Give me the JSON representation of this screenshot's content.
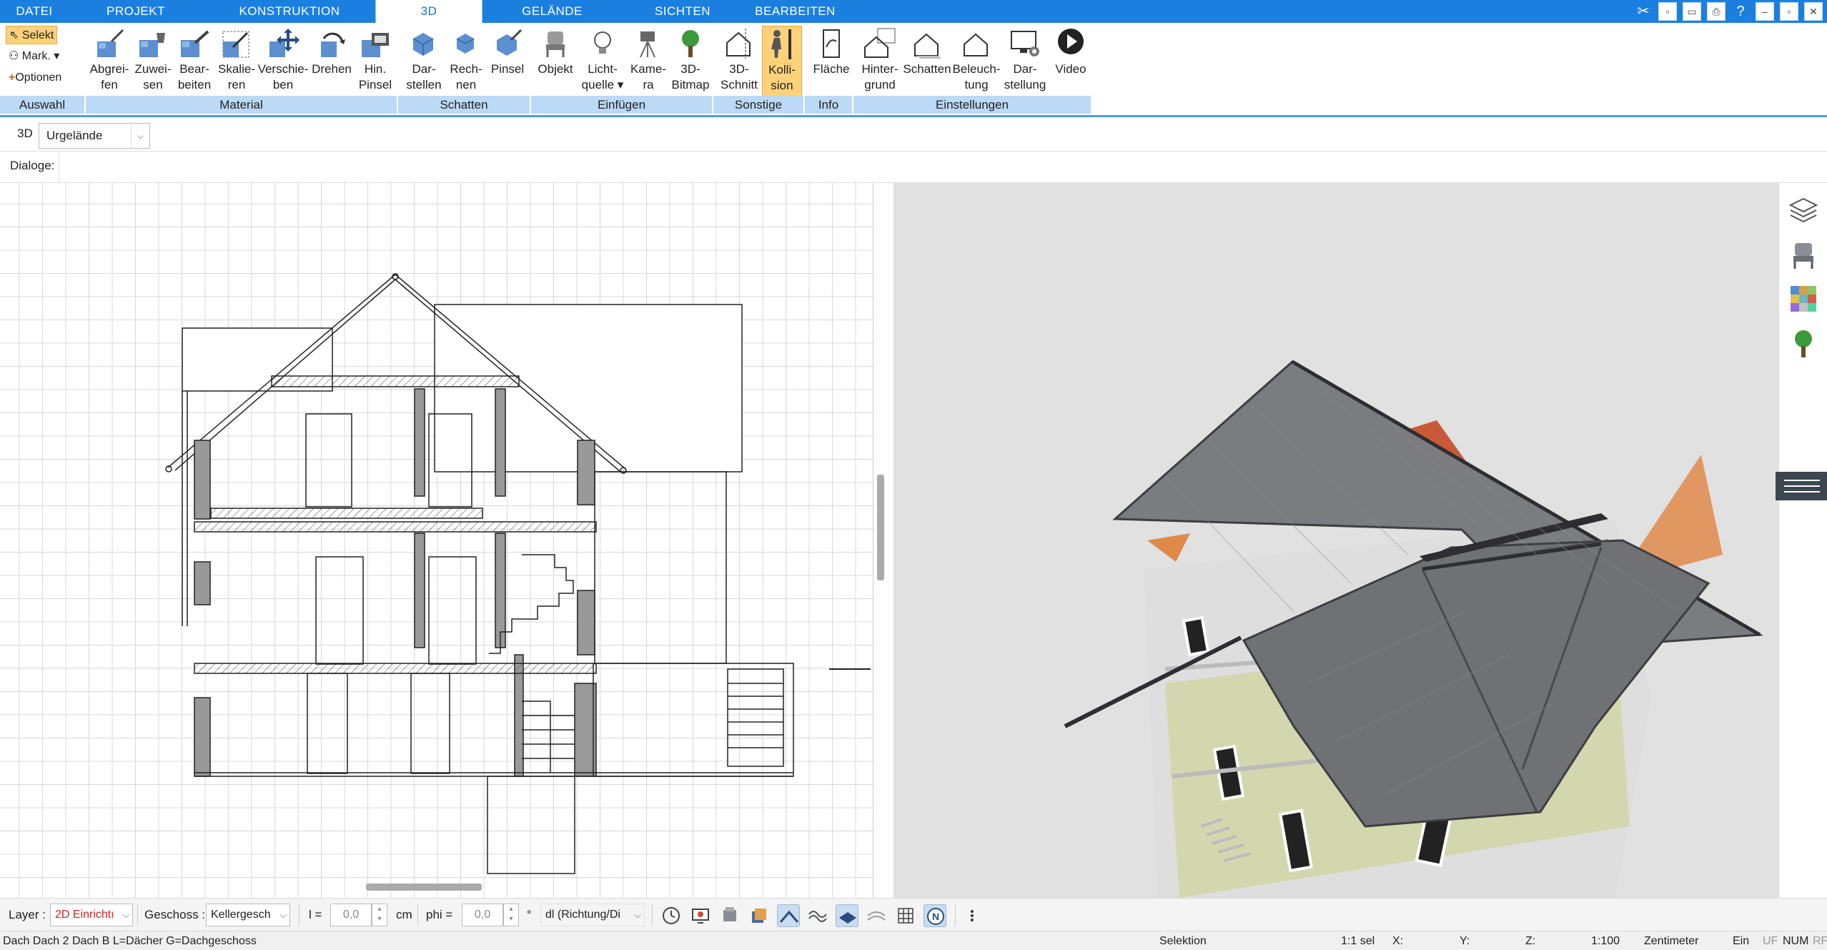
{
  "menu": {
    "tabs": [
      "DATEI",
      "PROJEKT",
      "KONSTRUKTION",
      "3D",
      "GELÄNDE",
      "SICHTEN",
      "BEARBEITEN"
    ],
    "active": "3D"
  },
  "ribbon": {
    "selection": {
      "select": "Selekt",
      "mark": "Mark.",
      "options": "Optionen",
      "group": "Auswahl"
    },
    "material": {
      "group": "Material",
      "buttons": [
        {
          "l1": "Abgrei-",
          "l2": "fen"
        },
        {
          "l1": "Zuwei-",
          "l2": "sen"
        },
        {
          "l1": "Bear-",
          "l2": "beiten"
        },
        {
          "l1": "Skalie-",
          "l2": "ren"
        },
        {
          "l1": "Verschie-",
          "l2": "ben"
        },
        {
          "l1": "Drehen",
          "l2": ""
        },
        {
          "l1": "Hin.",
          "l2": "Pinsel"
        }
      ]
    },
    "schatten": {
      "group": "Schatten",
      "buttons": [
        {
          "l1": "Dar-",
          "l2": "stellen"
        },
        {
          "l1": "Rech-",
          "l2": "nen"
        },
        {
          "l1": "Pinsel",
          "l2": ""
        }
      ]
    },
    "einfuegen": {
      "group": "Einfügen",
      "buttons": [
        {
          "l1": "Objekt",
          "l2": ""
        },
        {
          "l1": "Licht-",
          "l2": "quelle ▾"
        },
        {
          "l1": "Kame-",
          "l2": "ra"
        },
        {
          "l1": "3D-",
          "l2": "Bitmap"
        }
      ]
    },
    "sonstige": {
      "group": "Sonstige",
      "buttons": [
        {
          "l1": "3D-",
          "l2": "Schnitt"
        },
        {
          "l1": "Kolli-",
          "l2": "sion"
        }
      ]
    },
    "info": {
      "group": "Info",
      "buttons": [
        {
          "l1": "Fläche",
          "l2": ""
        }
      ]
    },
    "einstellungen": {
      "group": "Einstellungen",
      "buttons": [
        {
          "l1": "Hinter-",
          "l2": "grund"
        },
        {
          "l1": "Schatten",
          "l2": ""
        },
        {
          "l1": "Beleuch-",
          "l2": "tung"
        },
        {
          "l1": "Dar-",
          "l2": "stellung"
        },
        {
          "l1": "Video",
          "l2": ""
        }
      ]
    }
  },
  "bar2": {
    "mode": "3D",
    "terrain_select": "Urgelände"
  },
  "bar3": {
    "dialogs_label": "Dialoge:"
  },
  "bottom": {
    "layer_label": "Layer :",
    "layer_value": "2D Einrichtı",
    "floor_label": "Geschoss :",
    "floor_value": "Kellergesch",
    "l_label": "l =",
    "l_value": "0,0",
    "l_unit": "cm",
    "phi_label": "phi =",
    "phi_value": "0,0",
    "phi_unit": "°",
    "dl_value": "dl (Richtung/Di"
  },
  "status": {
    "left": "Dach Dach 2 Dach B L=Dächer G=Dachgeschoss",
    "mode": "Selektion",
    "scale_sel": "1:1 sel",
    "x": "X:",
    "y": "Y:",
    "z": "Z:",
    "scale": "1:100",
    "unit": "Zentimeter",
    "ein": "Ein",
    "uf": "UF",
    "num": "NUM",
    "rf": "RF"
  },
  "colors": {
    "accent": "#1b7fe0",
    "group_bg": "#bcd9f6",
    "active_button": "#ffd27a",
    "layer_text": "#d22222"
  }
}
